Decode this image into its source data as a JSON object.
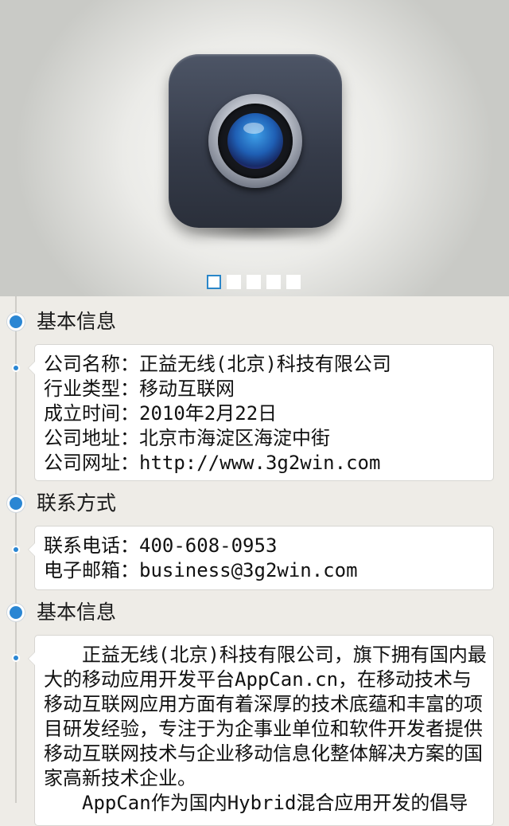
{
  "banner": {
    "image": "camera-app-icon",
    "pagination": {
      "count": 5,
      "active_index": 0
    }
  },
  "sections": [
    {
      "title": "基本信息",
      "rows": [
        "公司名称：正益无线(北京)科技有限公司",
        "行业类型：移动互联网",
        "成立时间：2010年2月22日",
        "公司地址：北京市海淀区海淀中街",
        "公司网址：http://www.3g2win.com"
      ]
    },
    {
      "title": "联系方式",
      "rows": [
        "联系电话：400-608-0953",
        "电子邮箱：business@3g2win.com"
      ]
    },
    {
      "title": "基本信息",
      "paragraphs": [
        "正益无线(北京)科技有限公司，旗下拥有国内最大的移动应用开发平台AppCan.cn，在移动技术与移动互联网应用方面有着深厚的技术底蕴和丰富的项目研发经验，专注于为企事业单位和软件开发者提供移动互联网技术与企业移动信息化整体解决方案的国家高新技术企业。",
        "AppCan作为国内Hybrid混合应用开发的倡导"
      ]
    }
  ],
  "colors": {
    "accent": "#2a86d3",
    "background": "#eeece7",
    "card": "#ffffff"
  }
}
